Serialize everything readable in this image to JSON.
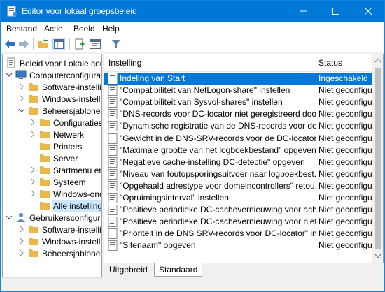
{
  "window": {
    "title": "Editor voor lokaal groepsbeleid",
    "accent": "#0078d7"
  },
  "menu": [
    "Bestand",
    "Actie",
    "Beeld",
    "Help"
  ],
  "tree": {
    "root": "Beleid voor Lokale comp",
    "computer": "Computerconfigurati",
    "software": "Software-instellinc",
    "windows": "Windows-instellin",
    "admin": "Beheersjablonen",
    "children": [
      "Configuraties",
      "Netwerk",
      "Printers",
      "Server",
      "Startmenu en",
      "Systeem",
      "Windows-ond"
    ],
    "all": "Alle instelling",
    "user": "Gebruikersconfigurat",
    "user_software": "Software-instellin",
    "user_windows": "Windows-instellin",
    "user_admin": "Beheersjablonen"
  },
  "list": {
    "columns": {
      "name": "Instelling",
      "status": "Status"
    },
    "rows": [
      {
        "name": "Indeling van Start",
        "status": "Ingeschakeld",
        "selected": true
      },
      {
        "name": "\"Compatibiliteit van NetLogon-share\" instellen",
        "status": "Niet geconfigu"
      },
      {
        "name": "\"Compatibiliteit van Sysvol-shares\" instellen",
        "status": "Niet geconfigu"
      },
      {
        "name": "\"DNS-records voor DC-locator niet geregistreerd doo...",
        "status": "Niet geconfigu"
      },
      {
        "name": "\"Dynamische registratie van de DNS-records voor de ...",
        "status": "Niet geconfigu"
      },
      {
        "name": "\"Gewicht in de DNS-SRV-records voor de DC-locator\"...",
        "status": "Niet geconfigu"
      },
      {
        "name": "\"Maximale grootte van het logboekbestand\" opgeven",
        "status": "Niet geconfigu"
      },
      {
        "name": "\"Negatieve cache-instelling DC-detectie\" opgeven",
        "status": "Niet geconfigu"
      },
      {
        "name": "\"Niveau van foutopsporingsuitvoer naar logboekbest...",
        "status": "Niet geconfigu"
      },
      {
        "name": "\"Opgehaald adrestype voor domeincontrollers\" retou...",
        "status": "Niet geconfigu"
      },
      {
        "name": "\"Opruimingsinterval\" instellen",
        "status": "Niet geconfigu"
      },
      {
        "name": "\"Positieve periodieke DC-cachevernieuwing voor ach...",
        "status": "Niet geconfigu"
      },
      {
        "name": "\"Positieve periodieke DC-cachevernieuwing voor niet...",
        "status": "Niet geconfigu"
      },
      {
        "name": "\"Prioriteit in de DNS SRV-records voor DC-locator\" in...",
        "status": "Niet geconfigu"
      },
      {
        "name": "\"Sitenaam\" opgeven",
        "status": "Niet geconfigu"
      }
    ]
  },
  "tabs": [
    "Uitgebreid",
    "Standaard"
  ]
}
